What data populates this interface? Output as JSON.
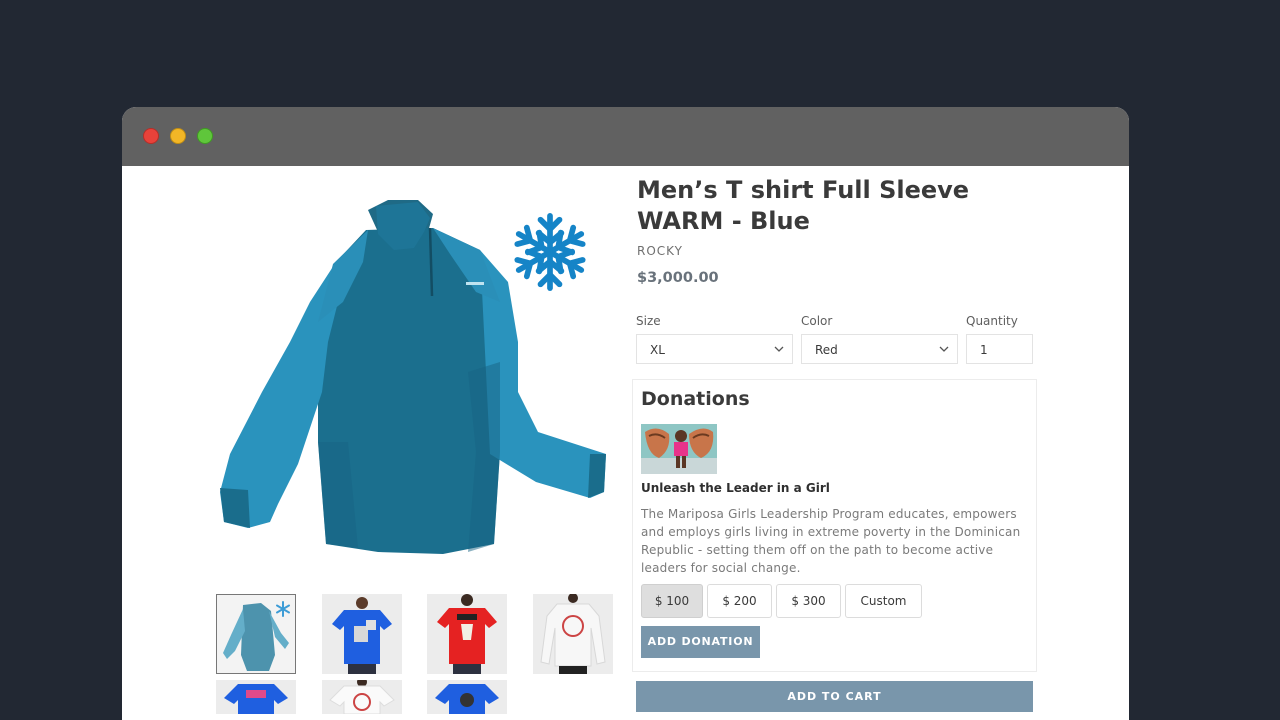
{
  "window": {
    "controls": [
      "close",
      "minimize",
      "maximize"
    ]
  },
  "product": {
    "title": "Men’s T shirt Full Sleeve WARM - Blue",
    "vendor": "ROCKY",
    "price": "$3,000.00",
    "main_image_icon": "snowflake-icon",
    "thumbnails": [
      {
        "name": "blue-fleece-thumb",
        "active": true
      },
      {
        "name": "blue-tshirt-thumb",
        "active": false
      },
      {
        "name": "red-tshirt-thumb",
        "active": false
      },
      {
        "name": "white-longsleeve-thumb",
        "active": false
      },
      {
        "name": "blue-print-tshirt-thumb",
        "active": false
      },
      {
        "name": "white-print-tshirt-thumb",
        "active": false
      },
      {
        "name": "blue-tshirt-2-thumb",
        "active": false
      }
    ]
  },
  "options": {
    "size": {
      "label": "Size",
      "value": "XL"
    },
    "color": {
      "label": "Color",
      "value": "Red"
    },
    "quantity": {
      "label": "Quantity",
      "value": "1"
    }
  },
  "donations": {
    "heading": "Donations",
    "cause_title": "Unleash the Leader in a Girl",
    "description": "The Mariposa Girls Leadership Program educates, empowers and employs girls living in extreme poverty in the Dominican Republic - setting them off on the path to become active leaders for social change.",
    "amounts": [
      "$ 100",
      "$ 200",
      "$ 300",
      "Custom"
    ],
    "selected_amount": "$ 100",
    "add_button": "ADD DONATION"
  },
  "cart": {
    "add_button": "ADD TO CART"
  },
  "colors": {
    "page_background": "#222833",
    "titlebar": "#616161",
    "button": "#7996ab",
    "price": "#69727b"
  }
}
